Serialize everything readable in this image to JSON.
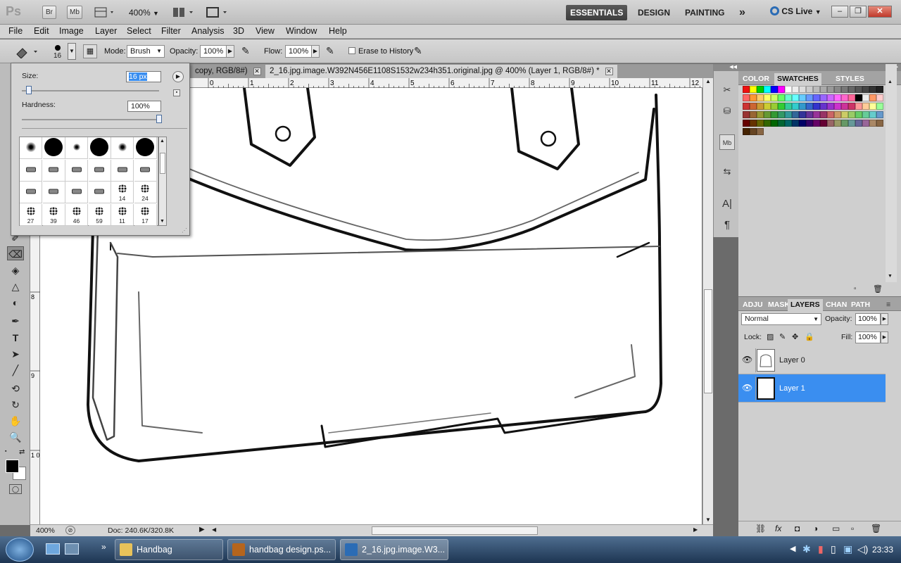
{
  "appbar": {
    "logo": "Ps",
    "br_label": "Br",
    "mb_label": "Mb",
    "zoom": "400%",
    "workspaces": [
      "ESSENTIALS",
      "DESIGN",
      "PAINTING"
    ],
    "overflow": "»",
    "cslive": "CS Live"
  },
  "menu": [
    "File",
    "Edit",
    "Image",
    "Layer",
    "Select",
    "Filter",
    "Analysis",
    "3D",
    "View",
    "Window",
    "Help"
  ],
  "options": {
    "brush_size": "16",
    "mode_label": "Mode:",
    "mode_value": "Brush",
    "opacity_label": "Opacity:",
    "opacity_value": "100%",
    "flow_label": "Flow:",
    "flow_value": "100%",
    "erase_history": "Erase to History"
  },
  "brush_popup": {
    "size_label": "Size:",
    "size_value": "16 px",
    "hardness_label": "Hardness:",
    "hardness_value": "100%",
    "size_slider_fraction": 0.05,
    "hardness_slider_fraction": 1.0,
    "presets": [
      {
        "kind": "soft",
        "d": 14,
        "num": ""
      },
      {
        "kind": "hard",
        "d": 26,
        "num": ""
      },
      {
        "kind": "soft",
        "d": 10,
        "num": ""
      },
      {
        "kind": "hard",
        "d": 26,
        "num": ""
      },
      {
        "kind": "soft",
        "d": 12,
        "num": ""
      },
      {
        "kind": "hard",
        "d": 26,
        "num": ""
      },
      {
        "kind": "tip",
        "num": ""
      },
      {
        "kind": "tip",
        "num": ""
      },
      {
        "kind": "tip",
        "num": ""
      },
      {
        "kind": "tip",
        "num": ""
      },
      {
        "kind": "tip",
        "num": ""
      },
      {
        "kind": "tip",
        "num": ""
      },
      {
        "kind": "tip",
        "num": ""
      },
      {
        "kind": "tip",
        "num": ""
      },
      {
        "kind": "tip",
        "num": ""
      },
      {
        "kind": "tip",
        "num": ""
      },
      {
        "kind": "splat",
        "num": "14"
      },
      {
        "kind": "splat",
        "num": "24"
      },
      {
        "kind": "splat",
        "num": "27"
      },
      {
        "kind": "splat",
        "num": "39"
      },
      {
        "kind": "splat",
        "num": "46"
      },
      {
        "kind": "splat",
        "num": "59"
      },
      {
        "kind": "splat",
        "num": "11"
      },
      {
        "kind": "splat",
        "num": "17"
      }
    ]
  },
  "doc_tabs": [
    {
      "label": "copy, RGB/8#)",
      "active": false
    },
    {
      "label": "2_16.jpg.image.W392N456E1108S1532w234h351.original.jpg @ 400% (Layer 1, RGB/8#) *",
      "active": true
    }
  ],
  "ruler_h": [
    "0",
    "1",
    "2",
    "3",
    "4",
    "5",
    "6",
    "7",
    "8",
    "9",
    "10",
    "11",
    "12"
  ],
  "ruler_v": [
    "8",
    "9",
    "1 0"
  ],
  "status": {
    "zoom": "400%",
    "doc": "Doc: 240.6K/320.8K"
  },
  "swatch_tabs": [
    "COLOR",
    "SWATCHES",
    "STYLES"
  ],
  "layer_tabs": [
    "ADJU",
    "MASK",
    "LAYERS",
    "CHAN",
    "PATH"
  ],
  "layers_panel": {
    "blend_mode": "Normal",
    "opacity_label": "Opacity:",
    "opacity_value": "100%",
    "lock_label": "Lock:",
    "fill_label": "Fill:",
    "fill_value": "100%",
    "layers": [
      {
        "name": "Layer 0",
        "selected": false
      },
      {
        "name": "Layer 1",
        "selected": true
      }
    ]
  },
  "taskbar": {
    "items": [
      {
        "label": "Handbag",
        "color": "#e8c25a",
        "active": false
      },
      {
        "label": "handbag design.ps...",
        "color": "#b5651d",
        "active": false
      },
      {
        "label": "2_16.jpg.image.W3...",
        "color": "#2b6cb5",
        "active": true
      }
    ],
    "time": "23:33"
  },
  "colors": {
    "selection": "#3a8ef0",
    "ps_blue": "#2b6cb5"
  }
}
